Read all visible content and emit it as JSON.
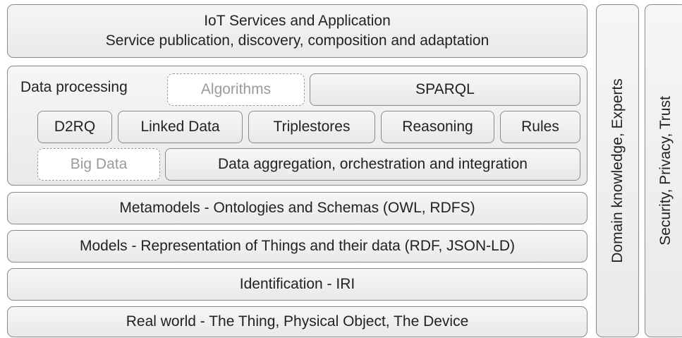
{
  "iot_services": {
    "line1": "IoT Services and Application",
    "line2": "Service publication, discovery, composition and adaptation"
  },
  "data_processing": {
    "label": "Data processing",
    "algorithms": "Algorithms",
    "sparql": "SPARQL",
    "row2": [
      "D2RQ",
      "Linked Data",
      "Triplestores",
      "Reasoning",
      "Rules"
    ],
    "big_data": "Big Data",
    "aggregation": "Data aggregation, orchestration and integration"
  },
  "layers": {
    "metamodels": "Metamodels - Ontologies and Schemas (OWL, RDFS)",
    "models": "Models - Representation of Things and their data (RDF, JSON-LD)",
    "identification": "Identification - IRI",
    "real_world": "Real world - The Thing, Physical Object, The Device"
  },
  "side_columns": {
    "domain": "Domain knowledge, Experts",
    "security": "Security, Privacy, Trust"
  }
}
